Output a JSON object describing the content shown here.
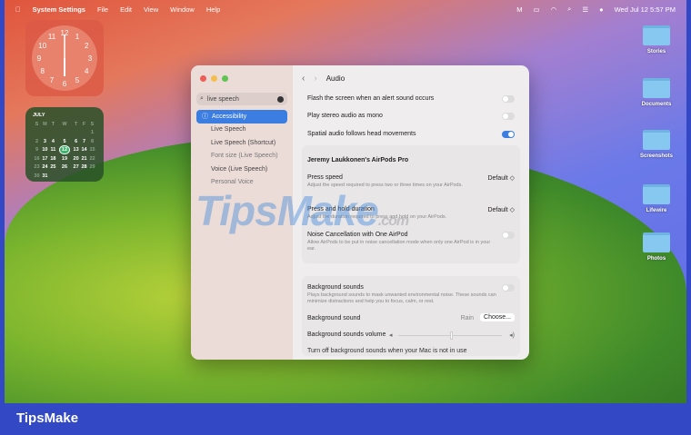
{
  "menubar": {
    "app": "System Settings",
    "items": [
      "File",
      "Edit",
      "View",
      "Window",
      "Help"
    ],
    "datetime": "Wed Jul 12  5:57 PM"
  },
  "clock": {
    "numbers": [
      "12",
      "1",
      "2",
      "3",
      "4",
      "5",
      "6",
      "7",
      "8",
      "9",
      "10",
      "11"
    ]
  },
  "calendar": {
    "month": "JULY",
    "weekdays": [
      "S",
      "M",
      "T",
      "W",
      "T",
      "F",
      "S"
    ],
    "today": "12",
    "weeks": [
      [
        "",
        "",
        "",
        "",
        "",
        "",
        "1"
      ],
      [
        "2",
        "3",
        "4",
        "5",
        "6",
        "7",
        "8"
      ],
      [
        "9",
        "10",
        "11",
        "12",
        "13",
        "14",
        "15"
      ],
      [
        "16",
        "17",
        "18",
        "19",
        "20",
        "21",
        "22"
      ],
      [
        "23",
        "24",
        "25",
        "26",
        "27",
        "28",
        "29"
      ],
      [
        "30",
        "31",
        "",
        "",
        "",
        "",
        ""
      ]
    ]
  },
  "desktop": {
    "folders": [
      "Stories",
      "Documents",
      "Screenshots",
      "Lifewire",
      "Photos"
    ]
  },
  "sidebar": {
    "search": "live speech",
    "items": [
      "Accessibility",
      "Live Speech",
      "Live Speech (Shortcut)",
      "Font size (Live Speech)",
      "Voice (Live Speech)",
      "Personal Voice"
    ]
  },
  "main": {
    "title": "Audio",
    "flash": "Flash the screen when an alert sound occurs",
    "mono": "Play stereo audio as mono",
    "spatial": "Spatial audio follows head movements",
    "airpods": "Jeremy Laukkonen's AirPods Pro",
    "press_speed": "Press speed",
    "press_speed_sub": "Adjust the speed required to press two or three times on your AirPods.",
    "press_speed_val": "Default ◇",
    "hold": "Press and hold duration",
    "hold_sub": "Adjust the duration required to press and hold on your AirPods.",
    "hold_val": "Default ◇",
    "noise": "Noise Cancellation with One AirPod",
    "noise_sub": "Allow AirPods to be put in noise cancellation mode when only one AirPod is in your ear.",
    "bg": "Background sounds",
    "bg_sub": "Plays background sounds to mask unwanted environmental noise. These sounds can minimize distractions and help you to focus, calm, or rest.",
    "bg_sound": "Background sound",
    "bg_sound_val": "Rain",
    "choose": "Choose...",
    "bg_vol": "Background sounds volume",
    "bg_vol_value": 0.5,
    "turnoff": "Turn off background sounds when your Mac is not in use"
  },
  "watermark": "TipsMake",
  "watermark_com": ".com",
  "banner": "TipsMake"
}
